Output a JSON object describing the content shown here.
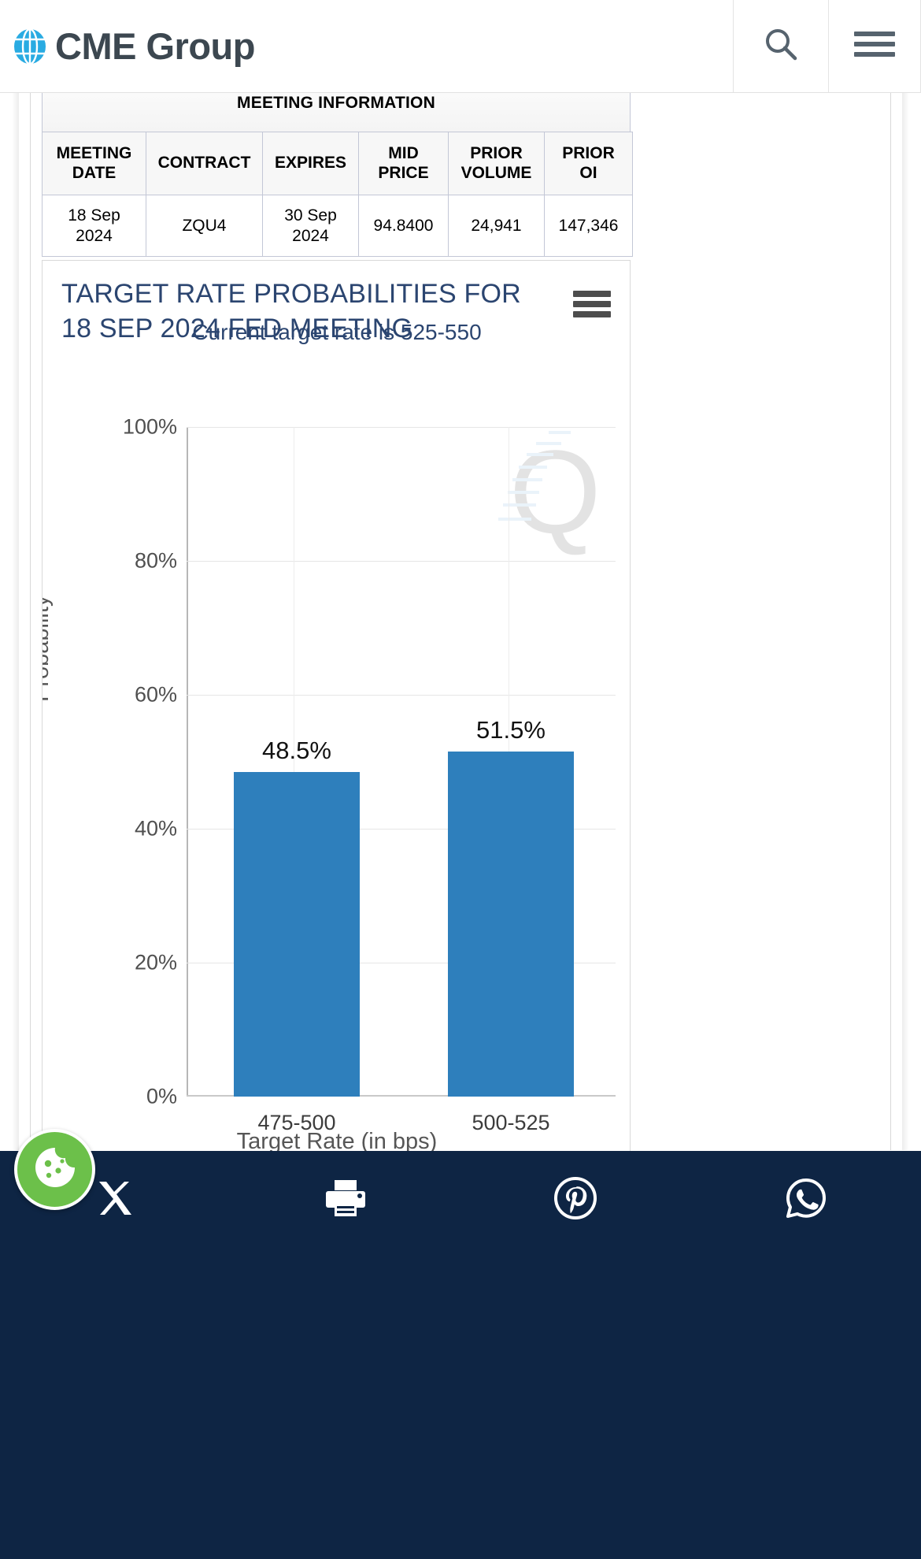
{
  "header": {
    "brand_name": "CME Group",
    "logo_icon": "globe-icon",
    "search_icon": "search-icon",
    "menu_icon": "hamburger-menu-icon"
  },
  "meeting_information": {
    "section_title": "MEETING INFORMATION",
    "columns": [
      "MEETING DATE",
      "CONTRACT",
      "EXPIRES",
      "MID PRICE",
      "PRIOR VOLUME",
      "PRIOR OI"
    ],
    "columns_split": [
      {
        "line1": "MEETING",
        "line2": "DATE"
      },
      {
        "line1": "CONTRACT",
        "line2": ""
      },
      {
        "line1": "EXPIRES",
        "line2": ""
      },
      {
        "line1": "MID",
        "line2": "PRICE"
      },
      {
        "line1": "PRIOR",
        "line2": "VOLUME"
      },
      {
        "line1": "PRIOR",
        "line2": "OI"
      }
    ],
    "rows": [
      {
        "meeting_date_line1": "18 Sep",
        "meeting_date_line2": "2024",
        "contract": "ZQU4",
        "expires_line1": "30 Sep",
        "expires_line2": "2024",
        "mid_price": "94.8400",
        "prior_volume": "24,941",
        "prior_oi": "147,346"
      }
    ]
  },
  "chart_panel": {
    "title": "TARGET RATE PROBABILITIES FOR 18 SEP 2024 FED MEETING",
    "subtitle": "Current target rate is 525-550",
    "context_menu_icon": "chart-context-menu-icon",
    "watermark": "Q"
  },
  "chart_data": {
    "type": "bar",
    "title": "TARGET RATE PROBABILITIES FOR 18 SEP 2024 FED MEETING",
    "subtitle": "Current target rate is 525-550",
    "categories": [
      "475-500",
      "500-525"
    ],
    "values": [
      48.5,
      51.5
    ],
    "data_labels": [
      "48.5%",
      "51.5%"
    ],
    "xlabel": "Target Rate (in bps)",
    "ylabel": "Probability",
    "ylim": [
      0,
      100
    ],
    "yticks": [
      0,
      20,
      40,
      60,
      80,
      100
    ],
    "ytick_labels": [
      "0%",
      "20%",
      "40%",
      "60%",
      "80%",
      "100%"
    ],
    "series_color": "#2e7fbc",
    "grid": true,
    "legend": "none"
  },
  "cookie_widget": {
    "icon": "cookie-icon",
    "color": "#6cc04a"
  },
  "footer": {
    "background": "#0e2544",
    "social": [
      {
        "icon": "x-twitter-icon",
        "name": "share-on-x"
      },
      {
        "icon": "printer-icon",
        "name": "print-page"
      },
      {
        "icon": "pinterest-icon",
        "name": "share-on-pinterest"
      },
      {
        "icon": "whatsapp-icon",
        "name": "share-on-whatsapp"
      }
    ]
  }
}
